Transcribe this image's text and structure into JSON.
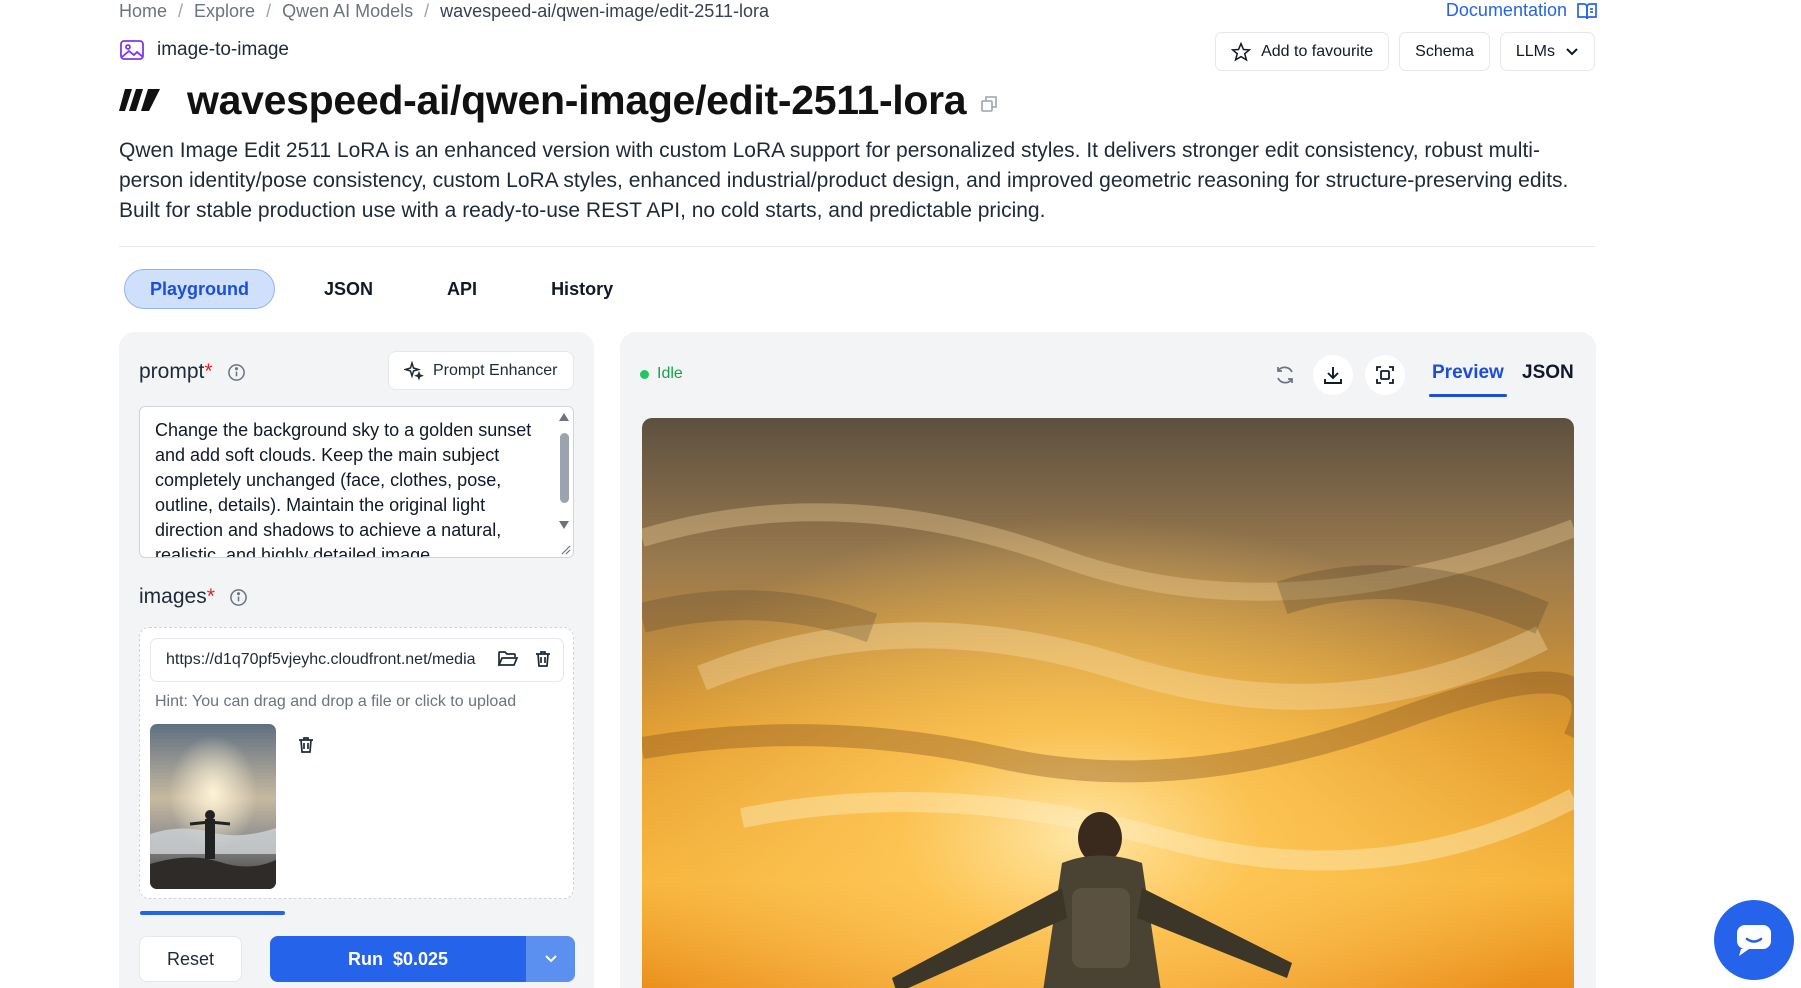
{
  "breadcrumb": {
    "items": [
      "Home",
      "Explore",
      "Qwen AI Models",
      "wavespeed-ai/qwen-image/edit-2511-lora"
    ],
    "separator": "/"
  },
  "header": {
    "documentation": "Documentation",
    "category": "image-to-image",
    "title": "wavespeed-ai/qwen-image/edit-2511-lora",
    "description": "Qwen Image Edit 2511 LoRA is an enhanced version with custom LoRA support for personalized styles. It delivers stronger edit consistency, robust multi-person identity/pose consistency, custom LoRA styles, enhanced industrial/product design, and improved geometric reasoning for structure-preserving edits. Built for stable production use with a ready-to-use REST API, no cold starts, and predictable pricing."
  },
  "top_buttons": {
    "favourite": "Add to favourite",
    "schema": "Schema",
    "llms": "LLMs"
  },
  "tabs": [
    "Playground",
    "JSON",
    "API",
    "History"
  ],
  "form": {
    "prompt_label": "prompt",
    "required_mark": "*",
    "prompt_enhancer": "Prompt Enhancer",
    "prompt_value": "Change the background sky to a golden sunset and add soft clouds. Keep the main subject completely unchanged (face, clothes, pose, outline, details). Maintain the original light direction and shadows to achieve a natural, realistic, and highly detailed image.",
    "images_label": "images",
    "image_url": "https://d1q70pf5vjeyhc.cloudfront.net/media",
    "hint": "Hint: You can drag and drop a file or click to upload",
    "reset": "Reset",
    "run": "Run",
    "price": "$0.025"
  },
  "output": {
    "status": "Idle",
    "status_color": "#22c55e",
    "preview_tab": "Preview",
    "json_tab": "JSON"
  },
  "colors": {
    "accent": "#2563eb",
    "active_tab_bg": "#cfe0fb"
  }
}
